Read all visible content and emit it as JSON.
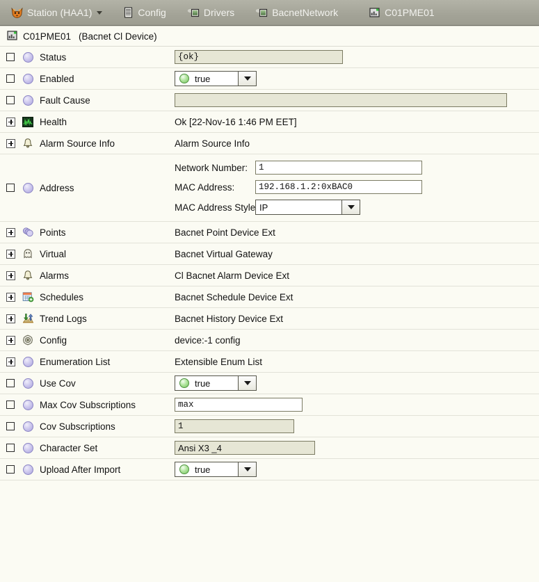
{
  "breadcrumb": {
    "items": [
      {
        "label": "Station (HAA1)",
        "icon": "fox-station-icon",
        "caret": true
      },
      {
        "label": "Config",
        "icon": "config-document-icon",
        "caret": false
      },
      {
        "label": "Drivers",
        "icon": "drivers-device-icon",
        "caret": false
      },
      {
        "label": "BacnetNetwork",
        "icon": "network-device-icon",
        "caret": false
      },
      {
        "label": "C01PME01",
        "icon": "bacnet-device-icon",
        "caret": false
      }
    ]
  },
  "sheet": {
    "header": {
      "icon": "bacnet-device-icon",
      "title": "C01PME01",
      "subtitle": "(Bacnet Cl Device)"
    },
    "rows": [
      {
        "marker": "checkbox",
        "icon": "sphere-purple-icon",
        "label": "Status",
        "control": "textfield",
        "value": "{ok}",
        "readonly": true,
        "width": "w-status"
      },
      {
        "marker": "checkbox",
        "icon": "sphere-purple-icon",
        "label": "Enabled",
        "control": "boolcombo",
        "value": "true"
      },
      {
        "marker": "checkbox",
        "icon": "sphere-purple-icon",
        "label": "Fault Cause",
        "control": "textfield",
        "value": "",
        "readonly": true,
        "width": "w-fault"
      },
      {
        "marker": "expand",
        "icon": "health-ecg-icon",
        "label": "Health",
        "control": "text",
        "value": "Ok [22-Nov-16 1:46 PM EET]"
      },
      {
        "marker": "expand",
        "icon": "bell-icon",
        "label": "Alarm Source Info",
        "control": "text",
        "value": "Alarm Source Info"
      },
      {
        "marker": "checkbox",
        "icon": "sphere-purple-icon",
        "label": "Address",
        "control": "address",
        "address": {
          "network_number_label": "Network Number:",
          "network_number_value": "1",
          "mac_address_label": "MAC Address:",
          "mac_address_value": "192.168.1.2:0xBAC0",
          "mac_style_label": "MAC Address Style:",
          "mac_style_value": "IP"
        }
      },
      {
        "marker": "expand",
        "icon": "points-stack-icon",
        "label": "Points",
        "control": "text",
        "value": "Bacnet Point Device Ext"
      },
      {
        "marker": "expand",
        "icon": "virtual-ghost-icon",
        "label": "Virtual",
        "control": "text",
        "value": "Bacnet Virtual Gateway"
      },
      {
        "marker": "expand",
        "icon": "bell-icon",
        "label": "Alarms",
        "control": "text",
        "value": "Cl Bacnet Alarm Device Ext"
      },
      {
        "marker": "expand",
        "icon": "calendar-add-icon",
        "label": "Schedules",
        "control": "text",
        "value": "Bacnet Schedule Device Ext"
      },
      {
        "marker": "expand",
        "icon": "trend-chart-icon",
        "label": "Trend Logs",
        "control": "text",
        "value": "Bacnet History Device Ext"
      },
      {
        "marker": "expand",
        "icon": "gear-icon",
        "label": "Config",
        "control": "text",
        "value": "device:-1 config"
      },
      {
        "marker": "expand",
        "icon": "sphere-purple-icon",
        "label": "Enumeration List",
        "control": "text",
        "value": "Extensible Enum List"
      },
      {
        "marker": "checkbox",
        "icon": "sphere-purple-icon",
        "label": "Use Cov",
        "control": "boolcombo",
        "value": "true"
      },
      {
        "marker": "checkbox",
        "icon": "sphere-purple-icon",
        "label": "Max Cov Subscriptions",
        "control": "textfield",
        "value": "max",
        "readonly": false,
        "width": "w-maxcov"
      },
      {
        "marker": "checkbox",
        "icon": "sphere-purple-icon",
        "label": "Cov Subscriptions",
        "control": "textfield",
        "value": "1",
        "readonly": true,
        "width": "w-cov"
      },
      {
        "marker": "checkbox",
        "icon": "sphere-purple-icon",
        "label": "Character Set",
        "control": "textfield",
        "value": "Ansi X3 _4",
        "readonly": true,
        "width": "w-charset",
        "sans": true
      },
      {
        "marker": "checkbox",
        "icon": "sphere-purple-icon",
        "label": "Upload After Import",
        "control": "boolcombo",
        "value": "true"
      }
    ]
  },
  "colors": {
    "toolbar": "#a3a397",
    "page_background": "#fbfbf3",
    "readonly_field": "#e6e6d5",
    "field_border": "#7b7b63",
    "row_separator": "#e2e2d8",
    "accent_true_green": "#7dc664",
    "sphere_purple": "#a9a2dd"
  }
}
